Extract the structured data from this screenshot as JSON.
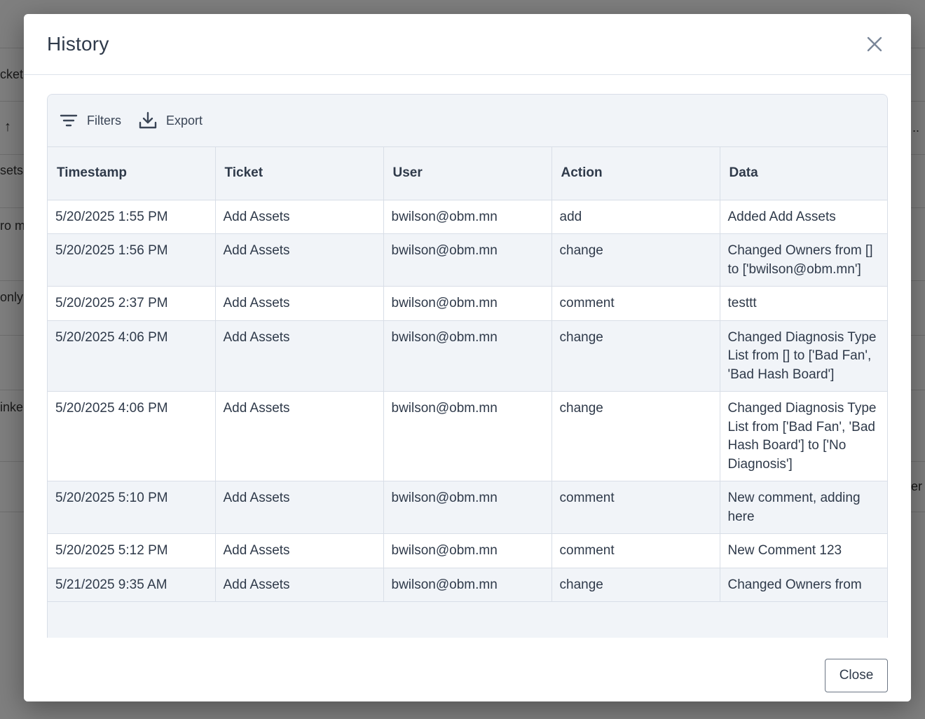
{
  "background": {
    "fragments": [
      "cket",
      "sets",
      "ro m",
      "only",
      "inke",
      "..",
      "er p"
    ]
  },
  "modal": {
    "title": "History",
    "toolbar": {
      "filters_label": "Filters",
      "export_label": "Export"
    },
    "columns": [
      "Timestamp",
      "Ticket",
      "User",
      "Action",
      "Data"
    ],
    "rows": [
      [
        "5/20/2025 1:55 PM",
        "Add Assets",
        "bwilson@obm.mn",
        "add",
        "Added Add Assets"
      ],
      [
        "5/20/2025 1:56 PM",
        "Add Assets",
        "bwilson@obm.mn",
        "change",
        "Changed Owners from [] to ['bwilson@obm.mn']"
      ],
      [
        "5/20/2025 2:37 PM",
        "Add Assets",
        "bwilson@obm.mn",
        "comment",
        "testtt"
      ],
      [
        "5/20/2025 4:06 PM",
        "Add Assets",
        "bwilson@obm.mn",
        "change",
        "Changed Diagnosis Type List from [] to ['Bad Fan', 'Bad Hash Board']"
      ],
      [
        "5/20/2025 4:06 PM",
        "Add Assets",
        "bwilson@obm.mn",
        "change",
        "Changed Diagnosis Type List from ['Bad Fan', 'Bad Hash Board'] to ['No Diagnosis']"
      ],
      [
        "5/20/2025 5:10 PM",
        "Add Assets",
        "bwilson@obm.mn",
        "comment",
        "New comment, adding here"
      ],
      [
        "5/20/2025 5:12 PM",
        "Add Assets",
        "bwilson@obm.mn",
        "comment",
        "New Comment 123"
      ],
      [
        "5/21/2025 9:35 AM",
        "Add Assets",
        "bwilson@obm.mn",
        "change",
        "Changed Owners from"
      ]
    ],
    "close_button_label": "Close"
  }
}
